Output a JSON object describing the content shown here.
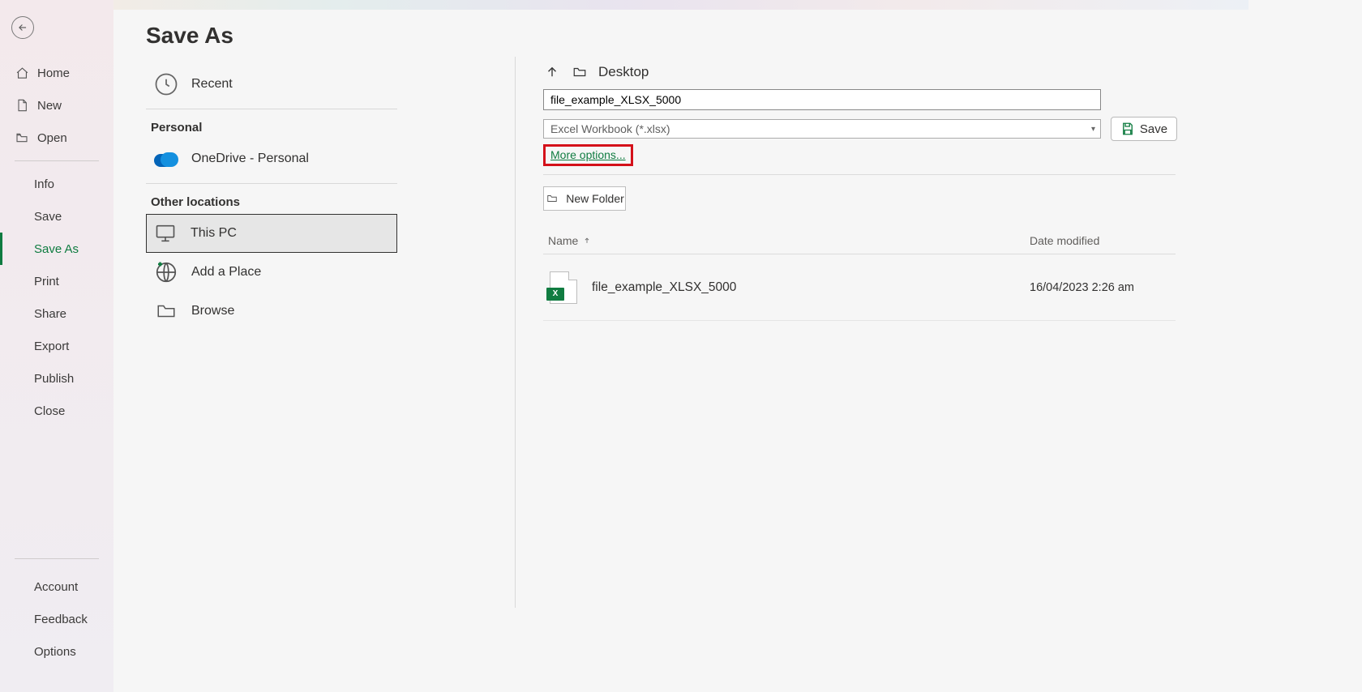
{
  "leftnav": {
    "top": [
      {
        "id": "home",
        "label": "Home"
      },
      {
        "id": "new",
        "label": "New"
      },
      {
        "id": "open",
        "label": "Open"
      }
    ],
    "mid": [
      {
        "id": "info",
        "label": "Info"
      },
      {
        "id": "save",
        "label": "Save"
      },
      {
        "id": "saveas",
        "label": "Save As",
        "active": true
      },
      {
        "id": "print",
        "label": "Print"
      },
      {
        "id": "share",
        "label": "Share"
      },
      {
        "id": "export",
        "label": "Export"
      },
      {
        "id": "publish",
        "label": "Publish"
      },
      {
        "id": "close",
        "label": "Close"
      }
    ],
    "bottom": [
      {
        "id": "account",
        "label": "Account"
      },
      {
        "id": "feedback",
        "label": "Feedback"
      },
      {
        "id": "options",
        "label": "Options"
      }
    ]
  },
  "page_title": "Save As",
  "locations": {
    "recent_label": "Recent",
    "personal_heading": "Personal",
    "onedrive_label": "OneDrive - Personal",
    "other_heading": "Other locations",
    "thispc_label": "This PC",
    "addplace_label": "Add a Place",
    "browse_label": "Browse"
  },
  "filepanel": {
    "path": "Desktop",
    "filename": "file_example_XLSX_5000",
    "filetype": "Excel Workbook (*.xlsx)",
    "more_options": "More options...",
    "save_label": "Save",
    "newfolder_label": "New Folder",
    "col_name": "Name",
    "col_date": "Date modified",
    "rows": [
      {
        "name": "file_example_XLSX_5000",
        "date": "16/04/2023 2:26 am"
      }
    ]
  }
}
